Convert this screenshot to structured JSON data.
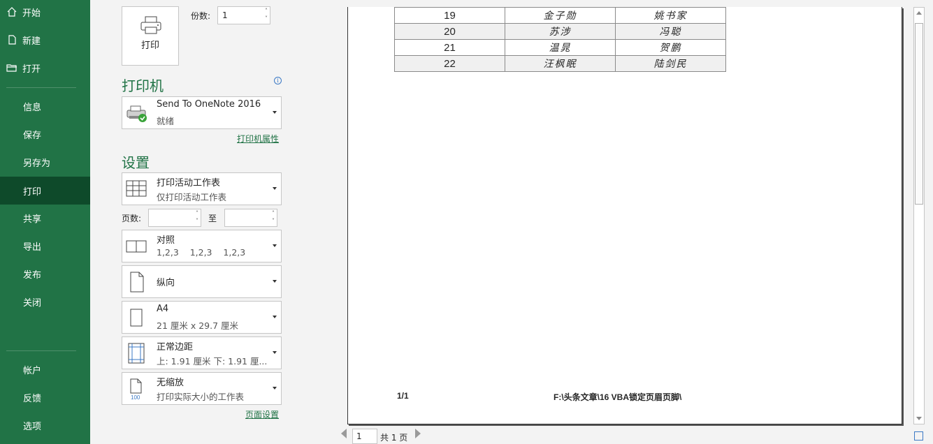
{
  "sidebar": {
    "items": [
      {
        "label": "开始",
        "icon": "home-icon"
      },
      {
        "label": "新建",
        "icon": "new-document-icon"
      },
      {
        "label": "打开",
        "icon": "open-folder-icon"
      },
      {
        "label": "信息"
      },
      {
        "label": "保存"
      },
      {
        "label": "另存为"
      },
      {
        "label": "打印"
      },
      {
        "label": "共享"
      },
      {
        "label": "导出"
      },
      {
        "label": "发布"
      },
      {
        "label": "关闭"
      },
      {
        "label": "帐户"
      },
      {
        "label": "反馈"
      },
      {
        "label": "选项"
      }
    ],
    "active": "打印",
    "bg_color": "#217346",
    "active_color": "#0e4a2a"
  },
  "print": {
    "button_label": "打印",
    "copies_label": "份数:",
    "copies_value": "1"
  },
  "printer": {
    "section_title": "打印机",
    "name": "Send To OneNote 2016",
    "status": "就绪",
    "properties_link": "打印机属性"
  },
  "settings": {
    "section_title": "设置",
    "what": {
      "title": "打印活动工作表",
      "sub": "仅打印活动工作表"
    },
    "pages_label": "页数:",
    "to_label": "至",
    "pages_from": "",
    "pages_to": "",
    "collate": {
      "title": "对照",
      "sub": "1,2,3    1,2,3    1,2,3"
    },
    "orientation": {
      "title": "纵向"
    },
    "paper": {
      "title": "A4",
      "sub": "21 厘米 x 29.7 厘米"
    },
    "margins": {
      "title": "正常边距",
      "sub": "上: 1.91 厘米 下: 1.91 厘..."
    },
    "scaling": {
      "title": "无缩放",
      "sub": "打印实际大小的工作表",
      "icon_text": "100"
    },
    "page_setup_link": "页面设置"
  },
  "preview": {
    "rows": [
      {
        "num": "19",
        "a": "金子勋",
        "b": "姚书家"
      },
      {
        "num": "20",
        "a": "苏涉",
        "b": "冯聪"
      },
      {
        "num": "21",
        "a": "温晁",
        "b": "贺鹏"
      },
      {
        "num": "22",
        "a": "汪枫眠",
        "b": "陆剑民"
      }
    ],
    "footer_left": "1/1",
    "footer_center": "F:\\头条文章\\16 VBA锁定页眉页脚\\"
  },
  "pager": {
    "current": "1",
    "total_label": "共 1 页"
  }
}
